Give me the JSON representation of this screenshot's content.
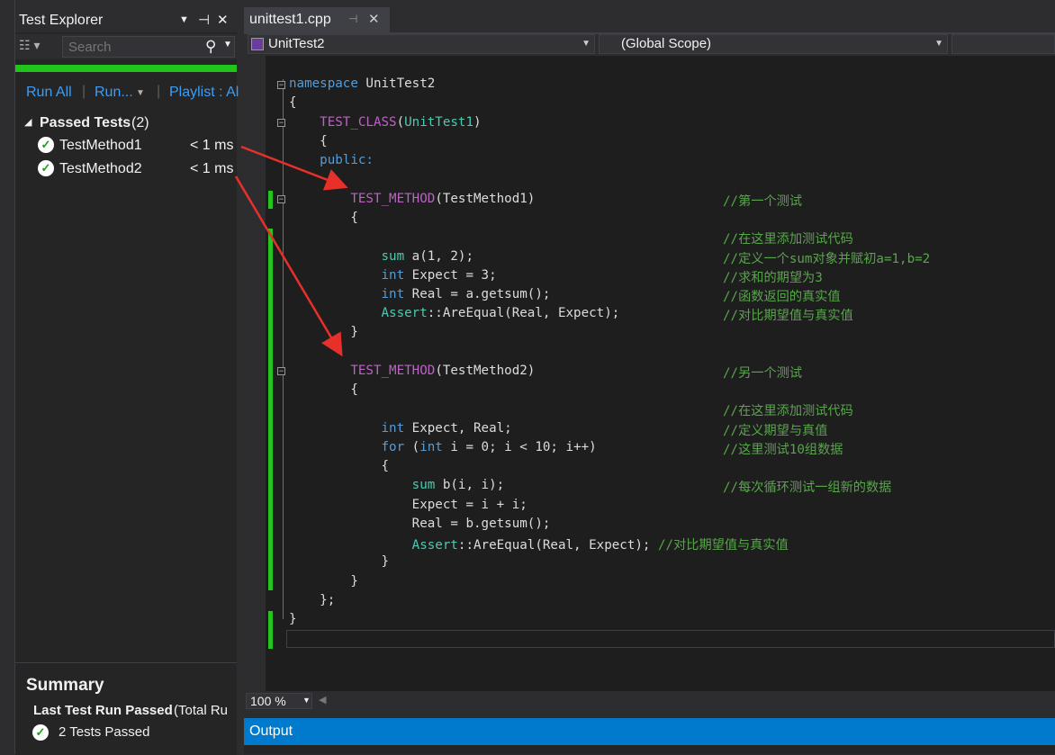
{
  "test_explorer": {
    "title": "Test Explorer",
    "search_placeholder": "Search",
    "commands": {
      "run_all": "Run All",
      "run": "Run...",
      "playlist": "Playlist : Al"
    },
    "group_label": "Passed Tests",
    "group_count": "(2)",
    "tests": [
      {
        "name": "TestMethod1",
        "duration": "< 1 ms"
      },
      {
        "name": "TestMethod2",
        "duration": "< 1 ms"
      }
    ],
    "summary": {
      "heading": "Summary",
      "last_run": "Last Test Run Passed",
      "last_run_suffix": "(Total Ru",
      "passed": "2 Tests Passed"
    },
    "progress_color": "#20c41a"
  },
  "editor": {
    "tab_label": "unittest1.cpp",
    "nav_left": "UnitTest2",
    "nav_right": "(Global Scope)",
    "zoom": "100 %",
    "code": {
      "l1": "namespace",
      "l1b": " UnitTest2",
      "l2": "{",
      "l3a": "TEST_CLASS",
      "l3b": "(",
      "l3c": "UnitTest1",
      "l3d": ")",
      "l4": "{",
      "l5": "public:",
      "l6a": "TEST_METHOD",
      "l6b": "(TestMethod1)",
      "l6c": "//第一个测试",
      "l7": "{",
      "l8c": "//在这里添加测试代码",
      "l9a": "sum",
      "l9b": " a(1, 2);",
      "l9c": "//定义一个sum对象并赋初a=1,b=2",
      "l10a": "int",
      "l10b": " Expect = 3;",
      "l10c": "//求和的期望为3",
      "l11a": "int",
      "l11b": " Real = a.getsum();",
      "l11c": "//函数返回的真实值",
      "l12a": "Assert",
      "l12b": "::AreEqual(Real, Expect);",
      "l12c": "//对比期望值与真实值",
      "l13": "}",
      "l14a": "TEST_METHOD",
      "l14b": "(TestMethod2)",
      "l14c": "//另一个测试",
      "l15": "{",
      "l16c": "//在这里添加测试代码",
      "l17a": "int",
      "l17b": " Expect, Real;",
      "l17c": "//定义期望与真值",
      "l18a": "for",
      "l18b": " (",
      "l18c": "int",
      "l18d": " i = 0; i < 10; i++)",
      "l18e": "//这里测试10组数据",
      "l19": "{",
      "l20a": "sum",
      "l20b": " b(i, i);",
      "l20c": "//每次循环测试一组新的数据",
      "l21": "Expect = i + i;",
      "l22": "Real = b.getsum();",
      "l23a": "Assert",
      "l23b": "::AreEqual(Real, Expect);",
      "l23c": " //对比期望值与真实值",
      "l24": "}",
      "l25": "}",
      "l26": "};",
      "l27": "}"
    }
  },
  "output": {
    "title": "Output"
  },
  "colors": {
    "accent": "#007acc",
    "arrow": "#e8302a",
    "link": "#3e9df2",
    "pass": "#20c41a"
  }
}
